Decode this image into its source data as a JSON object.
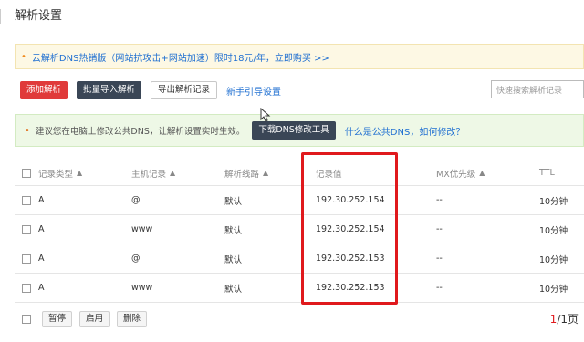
{
  "page": {
    "title": "解析设置"
  },
  "promo": {
    "text": "云解析DNS热销版（网站抗攻击+网站加速）限时18元/年，立即购买 >>"
  },
  "toolbar": {
    "add": "添加解析",
    "batch_import": "批量导入解析",
    "export": "导出解析记录",
    "guide": "新手引导设置"
  },
  "search": {
    "placeholder": "快速搜索解析记录"
  },
  "tip": {
    "text": "建议您在电脑上修改公共DNS，让解析设置实时生效。",
    "tool_button": "下载DNS修改工具",
    "link": "什么是公共DNS，如何修改？"
  },
  "table": {
    "headers": {
      "type": "记录类型",
      "host": "主机记录",
      "line": "解析线路",
      "value": "记录值",
      "mx": "MX优先级",
      "ttl": "TTL"
    },
    "sort_icon": "▲",
    "rows": [
      {
        "type": "A",
        "host": "@",
        "line": "默认",
        "value": "192.30.252.154",
        "mx": "--",
        "ttl": "10分钟"
      },
      {
        "type": "A",
        "host": "www",
        "line": "默认",
        "value": "192.30.252.154",
        "mx": "--",
        "ttl": "10分钟"
      },
      {
        "type": "A",
        "host": "@",
        "line": "默认",
        "value": "192.30.252.153",
        "mx": "--",
        "ttl": "10分钟"
      },
      {
        "type": "A",
        "host": "www",
        "line": "默认",
        "value": "192.30.252.153",
        "mx": "--",
        "ttl": "10分钟"
      }
    ]
  },
  "footer": {
    "pause": "暂停",
    "enable": "启用",
    "delete": "删除",
    "page_current": "1",
    "page_total": "/1页"
  },
  "colors": {
    "accent_red": "#e03a3a",
    "dark_button": "#3a4656",
    "link": "#1f6fd1",
    "highlight_box": "#e0191d"
  }
}
